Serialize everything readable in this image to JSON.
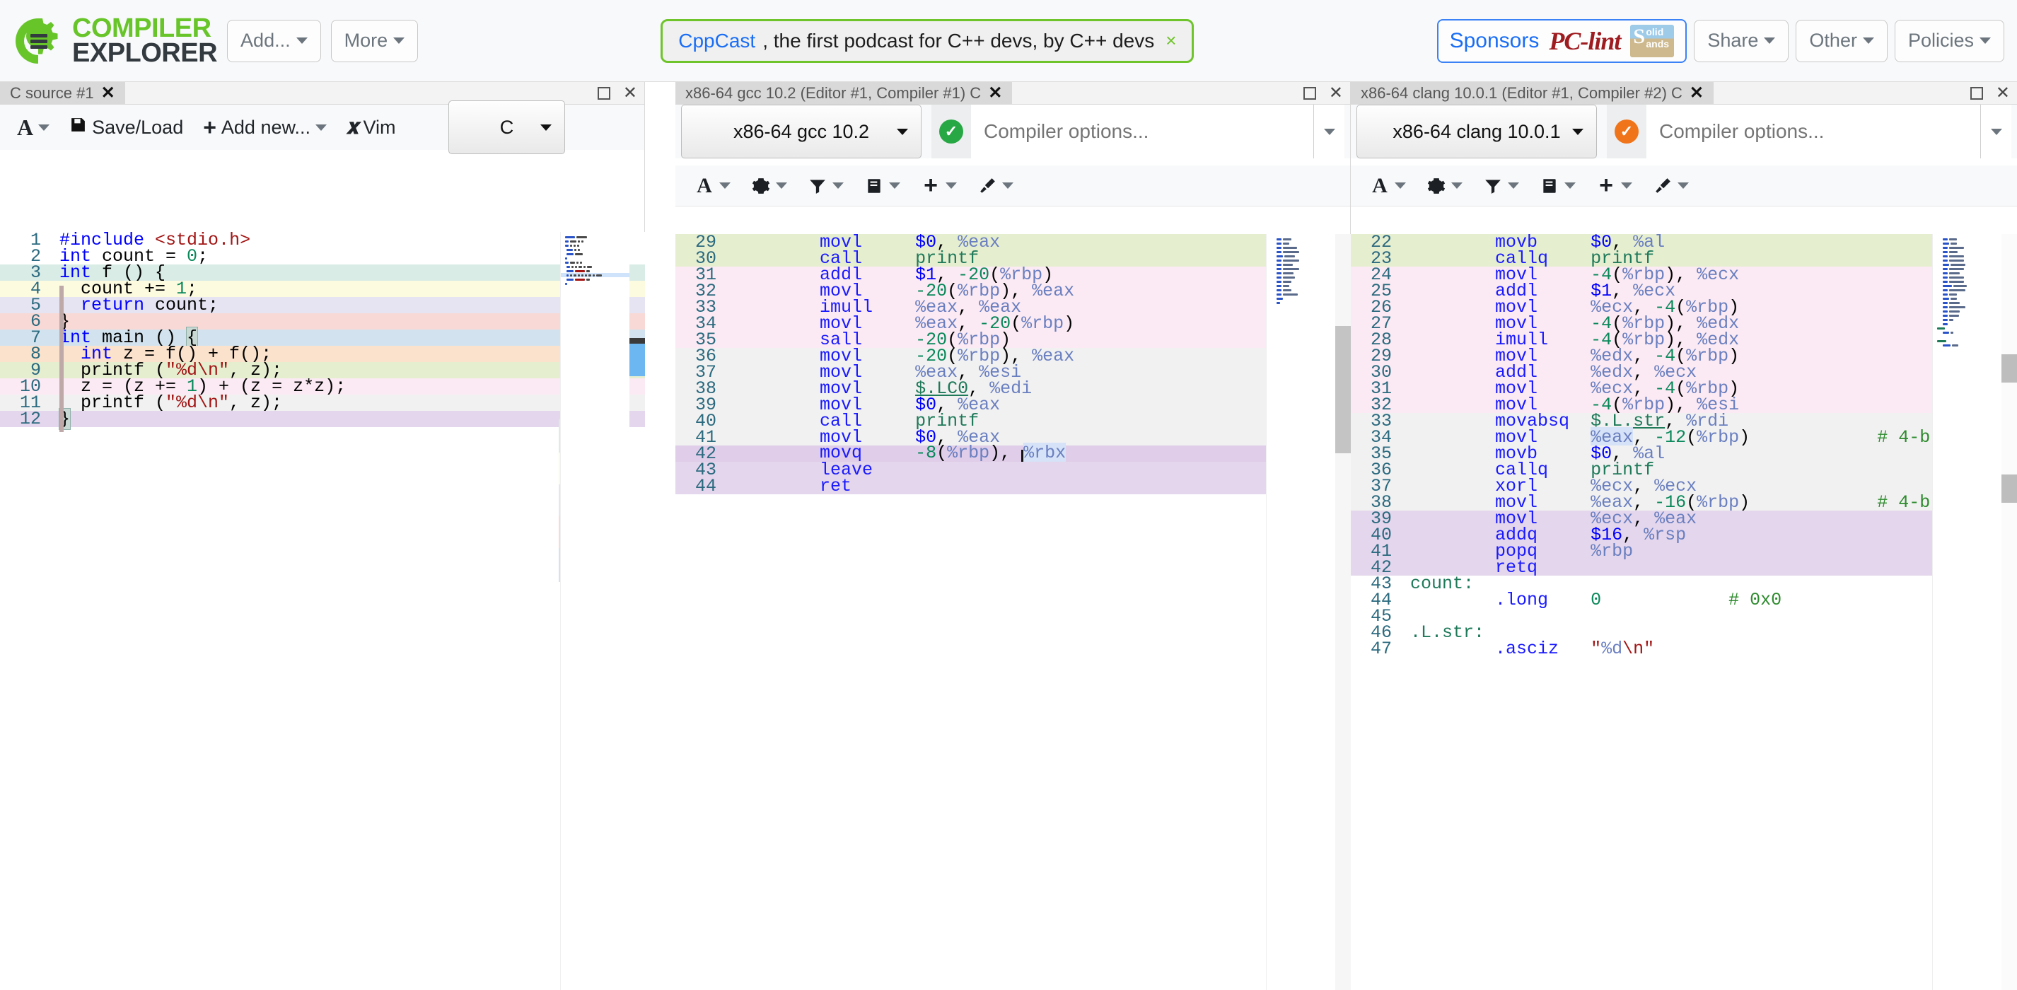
{
  "navbar": {
    "logo_line1": "COMPILER",
    "logo_line2": "EXPLORER",
    "add_label": "Add...",
    "more_label": "More",
    "banner_link": "CppCast",
    "banner_text": ", the first podcast for C++ devs, by C++ devs",
    "banner_close": "×",
    "sponsor_label": "Sponsors",
    "sponsor_brand": "PC-lint",
    "sponsor_logo_s": "S",
    "sponsor_logo_olid": "olid",
    "sponsor_logo_ands": "ands",
    "share_label": "Share",
    "other_label": "Other",
    "policies_label": "Policies"
  },
  "editor_panel": {
    "tab_title": "C source #1",
    "tab_close": "✕",
    "ctl_maximize": "maximize",
    "ctl_close": "✕",
    "toolbar": {
      "font_label": "A",
      "saveload_label": "Save/Load",
      "addnew_label": "Add new...",
      "vim_label": "Vim",
      "vim_glyph": "𝐱",
      "language_value": "C"
    },
    "code_lines": [
      {
        "num": "1",
        "highlight": "none"
      },
      {
        "num": "2",
        "highlight": "none"
      },
      {
        "num": "3",
        "highlight": "mint"
      },
      {
        "num": "4",
        "highlight": "yellow"
      },
      {
        "num": "5",
        "highlight": "lavender"
      },
      {
        "num": "6",
        "highlight": "salmon"
      },
      {
        "num": "7",
        "highlight": "blue"
      },
      {
        "num": "8",
        "highlight": "peach"
      },
      {
        "num": "9",
        "highlight": "green"
      },
      {
        "num": "10",
        "highlight": "pink"
      },
      {
        "num": "11",
        "highlight": "gray"
      },
      {
        "num": "12",
        "highlight": "purple"
      }
    ],
    "source_text": [
      "#include <stdio.h>",
      "int count = 0;",
      "int f () {",
      "  count += 1;",
      "  return count;",
      "}",
      "int main () {",
      "  int z = f() + f();",
      "  printf (\"%d\\n\", z);",
      "  z = (z += 1) + (z = z*z);",
      "  printf (\"%d\\n\", z);",
      "}"
    ]
  },
  "gcc_panel": {
    "tab_title": "x86-64 gcc 10.2 (Editor #1, Compiler #1) C",
    "tab_close": "✕",
    "compiler_value": "x86-64 gcc 10.2",
    "status_badge": "✓",
    "status_color": "#28a745",
    "options_placeholder": "Compiler options...",
    "options_value": "",
    "icons": [
      "font-icon",
      "gear-icon",
      "filter-icon",
      "libraries-icon",
      "add-icon",
      "tools-icon"
    ],
    "asm_lines": [
      {
        "num": "29",
        "mnemonic": "movl",
        "operands": "$0, %eax",
        "highlight": "green",
        "comment": ""
      },
      {
        "num": "30",
        "mnemonic": "call",
        "operands": "printf",
        "highlight": "green",
        "comment": ""
      },
      {
        "num": "31",
        "mnemonic": "addl",
        "operands": "$1, -20(%rbp)",
        "highlight": "pink",
        "comment": ""
      },
      {
        "num": "32",
        "mnemonic": "movl",
        "operands": "-20(%rbp), %eax",
        "highlight": "pink",
        "comment": ""
      },
      {
        "num": "33",
        "mnemonic": "imull",
        "operands": "%eax, %eax",
        "highlight": "pink",
        "comment": ""
      },
      {
        "num": "34",
        "mnemonic": "movl",
        "operands": "%eax, -20(%rbp)",
        "highlight": "pink",
        "comment": ""
      },
      {
        "num": "35",
        "mnemonic": "sall",
        "operands": "-20(%rbp)",
        "highlight": "pink",
        "comment": ""
      },
      {
        "num": "36",
        "mnemonic": "movl",
        "operands": "-20(%rbp), %eax",
        "highlight": "gray",
        "comment": ""
      },
      {
        "num": "37",
        "mnemonic": "movl",
        "operands": "%eax, %esi",
        "highlight": "gray",
        "comment": ""
      },
      {
        "num": "38",
        "mnemonic": "movl",
        "operands": "$.LC0, %edi",
        "highlight": "gray",
        "comment": ""
      },
      {
        "num": "39",
        "mnemonic": "movl",
        "operands": "$0, %eax",
        "highlight": "gray",
        "comment": ""
      },
      {
        "num": "40",
        "mnemonic": "call",
        "operands": "printf",
        "highlight": "gray",
        "comment": ""
      },
      {
        "num": "41",
        "mnemonic": "movl",
        "operands": "$0, %eax",
        "highlight": "gray",
        "comment": ""
      },
      {
        "num": "42",
        "mnemonic": "movq",
        "operands": "-8(%rbp), %rbx",
        "highlight": "purple-current",
        "comment": ""
      },
      {
        "num": "43",
        "mnemonic": "leave",
        "operands": "",
        "highlight": "purple",
        "comment": ""
      },
      {
        "num": "44",
        "mnemonic": "ret",
        "operands": "",
        "highlight": "purple",
        "comment": ""
      }
    ]
  },
  "clang_panel": {
    "tab_title": "x86-64 clang 10.0.1 (Editor #1, Compiler #2) C",
    "tab_close": "✕",
    "compiler_value": "x86-64 clang 10.0.1",
    "status_badge": "✓",
    "status_color": "#f0741a",
    "options_placeholder": "Compiler options...",
    "options_value": "",
    "icons": [
      "font-icon",
      "gear-icon",
      "filter-icon",
      "libraries-icon",
      "add-icon",
      "tools-icon"
    ],
    "asm_lines": [
      {
        "num": "22",
        "mnemonic": "movb",
        "operands": "$0, %al",
        "highlight": "green",
        "comment": ""
      },
      {
        "num": "23",
        "mnemonic": "callq",
        "operands": "printf",
        "highlight": "green",
        "comment": ""
      },
      {
        "num": "24",
        "mnemonic": "movl",
        "operands": "-4(%rbp), %ecx",
        "highlight": "pink",
        "comment": ""
      },
      {
        "num": "25",
        "mnemonic": "addl",
        "operands": "$1, %ecx",
        "highlight": "pink",
        "comment": ""
      },
      {
        "num": "26",
        "mnemonic": "movl",
        "operands": "%ecx, -4(%rbp)",
        "highlight": "pink",
        "comment": ""
      },
      {
        "num": "27",
        "mnemonic": "movl",
        "operands": "-4(%rbp), %edx",
        "highlight": "pink",
        "comment": ""
      },
      {
        "num": "28",
        "mnemonic": "imull",
        "operands": "-4(%rbp), %edx",
        "highlight": "pink",
        "comment": ""
      },
      {
        "num": "29",
        "mnemonic": "movl",
        "operands": "%edx, -4(%rbp)",
        "highlight": "pink",
        "comment": ""
      },
      {
        "num": "30",
        "mnemonic": "addl",
        "operands": "%edx, %ecx",
        "highlight": "pink",
        "comment": ""
      },
      {
        "num": "31",
        "mnemonic": "movl",
        "operands": "%ecx, -4(%rbp)",
        "highlight": "pink",
        "comment": ""
      },
      {
        "num": "32",
        "mnemonic": "movl",
        "operands": "-4(%rbp), %esi",
        "highlight": "pink",
        "comment": ""
      },
      {
        "num": "33",
        "mnemonic": "movabsq",
        "operands": "$.L.str, %rdi",
        "highlight": "gray",
        "comment": ""
      },
      {
        "num": "34",
        "mnemonic": "movl",
        "operands": "%eax, -12(%rbp)",
        "highlight": "gray",
        "comment": "# 4-b"
      },
      {
        "num": "35",
        "mnemonic": "movb",
        "operands": "$0, %al",
        "highlight": "gray",
        "comment": ""
      },
      {
        "num": "36",
        "mnemonic": "callq",
        "operands": "printf",
        "highlight": "gray",
        "comment": ""
      },
      {
        "num": "37",
        "mnemonic": "xorl",
        "operands": "%ecx, %ecx",
        "highlight": "gray",
        "comment": ""
      },
      {
        "num": "38",
        "mnemonic": "movl",
        "operands": "%eax, -16(%rbp)",
        "highlight": "gray",
        "comment": "# 4-b"
      },
      {
        "num": "39",
        "mnemonic": "movl",
        "operands": "%ecx, %eax",
        "highlight": "purple",
        "comment": ""
      },
      {
        "num": "40",
        "mnemonic": "addq",
        "operands": "$16, %rsp",
        "highlight": "purple",
        "comment": ""
      },
      {
        "num": "41",
        "mnemonic": "popq",
        "operands": "%rbp",
        "highlight": "purple",
        "comment": ""
      },
      {
        "num": "42",
        "mnemonic": "retq",
        "operands": "",
        "highlight": "purple",
        "comment": ""
      },
      {
        "num": "43",
        "label": "count:",
        "mnemonic": "",
        "operands": "",
        "highlight": "none",
        "comment": ""
      },
      {
        "num": "44",
        "mnemonic": ".long",
        "operands": "0",
        "highlight": "none",
        "comment": "# 0x0"
      },
      {
        "num": "45",
        "mnemonic": "",
        "operands": "",
        "highlight": "none",
        "comment": ""
      },
      {
        "num": "46",
        "label": ".L.str:",
        "mnemonic": "",
        "operands": "",
        "highlight": "none",
        "comment": ""
      },
      {
        "num": "47",
        "mnemonic": ".asciz",
        "operands": "\"%d\\n\"",
        "highlight": "none",
        "comment": ""
      }
    ]
  },
  "colors": {
    "mint": "#d9ece6",
    "yellow": "#fcfbe0",
    "lavender": "#e6e4f2",
    "salmon": "#f9d9d6",
    "blue": "#d2e3ef",
    "peach": "#fbe2cc",
    "green": "#e6eed0",
    "pink": "#fbeaf3",
    "gray": "#f1f1f1",
    "purple": "#e4d6ec",
    "purple-current": "#dfcde9",
    "none": "transparent"
  }
}
